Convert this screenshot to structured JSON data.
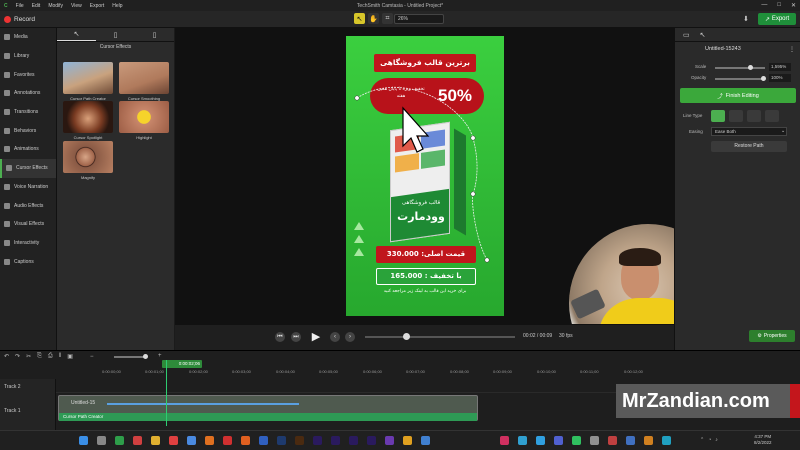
{
  "menu": [
    "File",
    "Edit",
    "Modify",
    "View",
    "Export",
    "Help"
  ],
  "app_title": "TechSmith Camtasia - Untitled Project*",
  "window_controls": [
    "—",
    "□",
    "✕"
  ],
  "toolbar": {
    "record_label": "Record",
    "zoom": "26%",
    "export_label": "Export"
  },
  "sidebar": {
    "items": [
      {
        "label": "Media",
        "icon": "media-icon"
      },
      {
        "label": "Library",
        "icon": "library-icon"
      },
      {
        "label": "Favorites",
        "icon": "star-icon"
      },
      {
        "label": "Annotations",
        "icon": "annotation-icon"
      },
      {
        "label": "Transitions",
        "icon": "transition-icon"
      },
      {
        "label": "Behaviors",
        "icon": "behavior-icon"
      },
      {
        "label": "Animations",
        "icon": "animation-icon"
      },
      {
        "label": "Cursor Effects",
        "icon": "cursor-icon"
      },
      {
        "label": "Voice Narration",
        "icon": "microphone-icon"
      },
      {
        "label": "Audio Effects",
        "icon": "audio-icon"
      },
      {
        "label": "Visual Effects",
        "icon": "visual-effect-icon"
      },
      {
        "label": "Interactivity",
        "icon": "interactivity-icon"
      },
      {
        "label": "Captions",
        "icon": "captions-icon"
      }
    ]
  },
  "library": {
    "title": "Cursor Effects",
    "effects": [
      {
        "label": "Cursor Path Creator"
      },
      {
        "label": "Cursor Smoothing"
      },
      {
        "label": "Cursor Spotlight"
      },
      {
        "label": "Highlight"
      },
      {
        "label": "Magnify"
      }
    ]
  },
  "banner": {
    "headline": "برترین قالب فروشگاهی",
    "discount": "50%",
    "discount_note": "تخفیف ویژه تا پایان همین هفته",
    "box_brand": "قالب فروشگاهی",
    "box_name": "وودمارت",
    "price_label": "قیمت اصلی: 330.000",
    "sale_label": "با تخفیف : 165.000",
    "footer": "برای خرید این قالب به لینک زیر مراجعه کنید"
  },
  "player": {
    "time": "00:02 / 00:09",
    "fps": "30 fps"
  },
  "properties": {
    "clip_name": "Untitled-15243",
    "scale_label": "Scale",
    "scale_value": "1,595%",
    "opacity_label": "Opacity",
    "opacity_value": "100%",
    "finish_label": "Finish Editing",
    "line_type_label": "Line Type",
    "easing_label": "Easing",
    "easing_value": "Ease Both",
    "restore_label": "Restore Path",
    "properties_btn": "Properties"
  },
  "timeline": {
    "playhead": "0:00:02;06",
    "ticks": [
      "0:00:00;00",
      "0:00:01;00",
      "0:00:02;00",
      "0:00:03;00",
      "0:00:04;00",
      "0:00:05;00",
      "0:00:06;00",
      "0:00:07;00",
      "0:00:08;00",
      "0:00:09;00",
      "0:00:10;00",
      "0:00:11;00",
      "0:00:12;00"
    ],
    "tracks": [
      "Track 2",
      "Track 1"
    ],
    "clip_label": "Untitled-15",
    "effect_label": "Cursor Path Creator"
  },
  "watermark": "MrZandian.com",
  "clock": {
    "time": "4:37 PM",
    "date": "8/2/2022"
  },
  "colors": {
    "accent": "#4caf50",
    "banner_green": "#35c43a",
    "banner_red": "#c0161c",
    "export": "#1f8f3a"
  }
}
